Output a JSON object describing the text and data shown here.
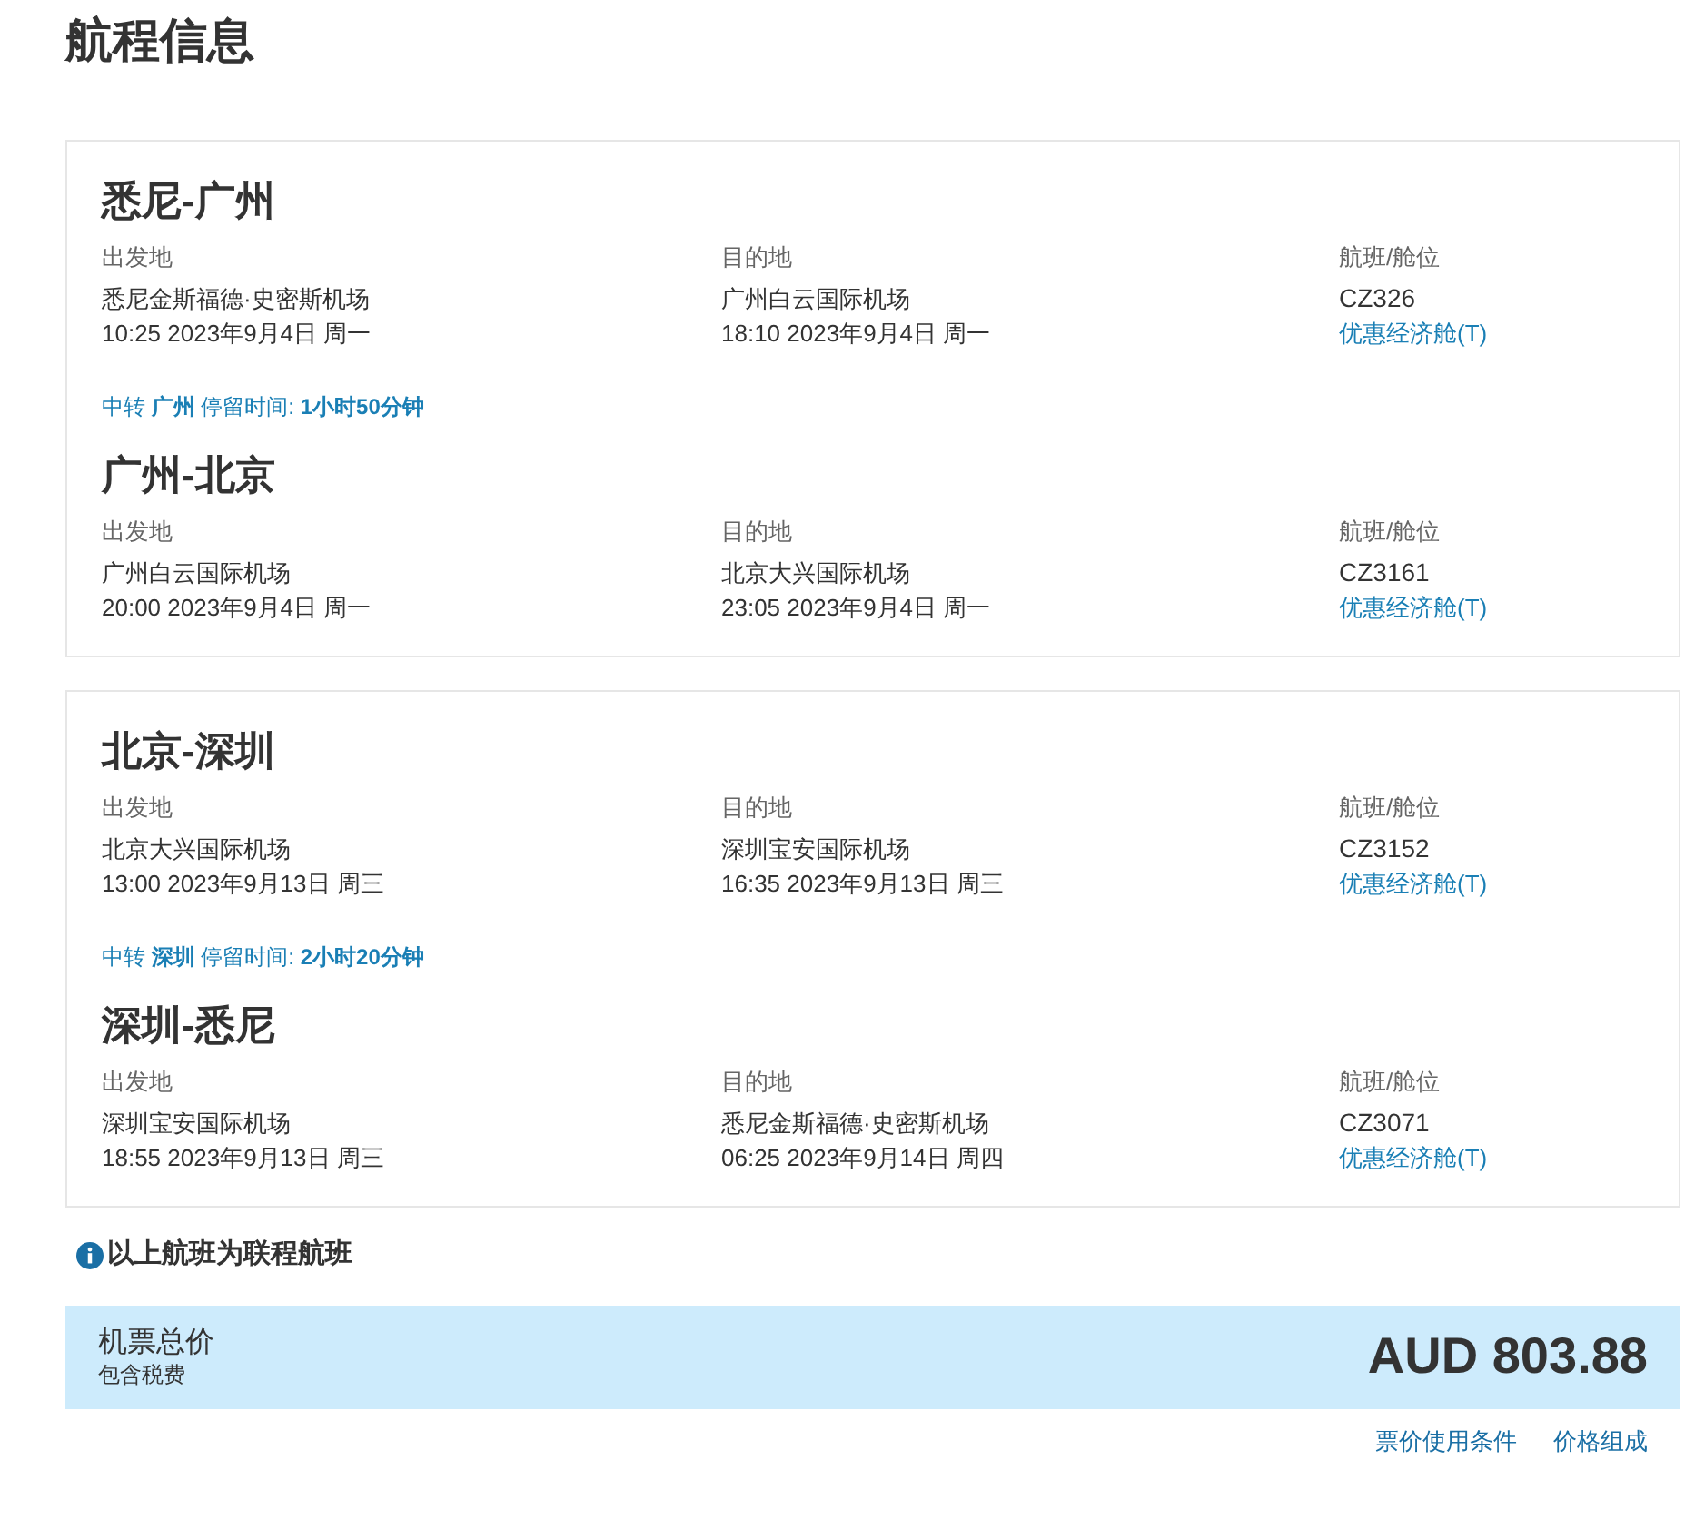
{
  "title": "航程信息",
  "cards": [
    {
      "items": [
        {
          "kind": "segment",
          "route": "悉尼-广州",
          "from_label": "出发地",
          "from_airport": "悉尼金斯福德·史密斯机场",
          "from_time": "10:25 2023年9月4日 周一",
          "to_label": "目的地",
          "to_airport": "广州白云国际机场",
          "to_time": "18:10 2023年9月4日 周一",
          "flight_label": "航班/舱位",
          "flight": "CZ326",
          "cabin": "优惠经济舱(T)"
        },
        {
          "kind": "transfer",
          "text": "中转 **广州** 停留时间: **1小时50分钟**"
        },
        {
          "kind": "segment",
          "route": "广州-北京",
          "from_label": "出发地",
          "from_airport": "广州白云国际机场",
          "from_time": "20:00 2023年9月4日 周一",
          "to_label": "目的地",
          "to_airport": "北京大兴国际机场",
          "to_time": "23:05 2023年9月4日 周一",
          "flight_label": "航班/舱位",
          "flight": "CZ3161",
          "cabin": "优惠经济舱(T)"
        }
      ]
    },
    {
      "items": [
        {
          "kind": "segment",
          "route": "北京-深圳",
          "from_label": "出发地",
          "from_airport": "北京大兴国际机场",
          "from_time": "13:00 2023年9月13日 周三",
          "to_label": "目的地",
          "to_airport": "深圳宝安国际机场",
          "to_time": "16:35 2023年9月13日 周三",
          "flight_label": "航班/舱位",
          "flight": "CZ3152",
          "cabin": "优惠经济舱(T)"
        },
        {
          "kind": "transfer",
          "text": "中转 **深圳** 停留时间: **2小时20分钟**"
        },
        {
          "kind": "segment",
          "route": "深圳-悉尼",
          "from_label": "出发地",
          "from_airport": "深圳宝安国际机场",
          "from_time": "18:55 2023年9月13日 周三",
          "to_label": "目的地",
          "to_airport": "悉尼金斯福德·史密斯机场",
          "to_time": "06:25 2023年9月14日 周四",
          "flight_label": "航班/舱位",
          "flight": "CZ3071",
          "cabin": "优惠经济舱(T)"
        }
      ]
    }
  ],
  "notice": "以上航班为联程航班",
  "total": {
    "label": "机票总价",
    "sublabel": "包含税费",
    "price": "AUD 803.88"
  },
  "links": [
    "票价使用条件",
    "价格组成"
  ]
}
